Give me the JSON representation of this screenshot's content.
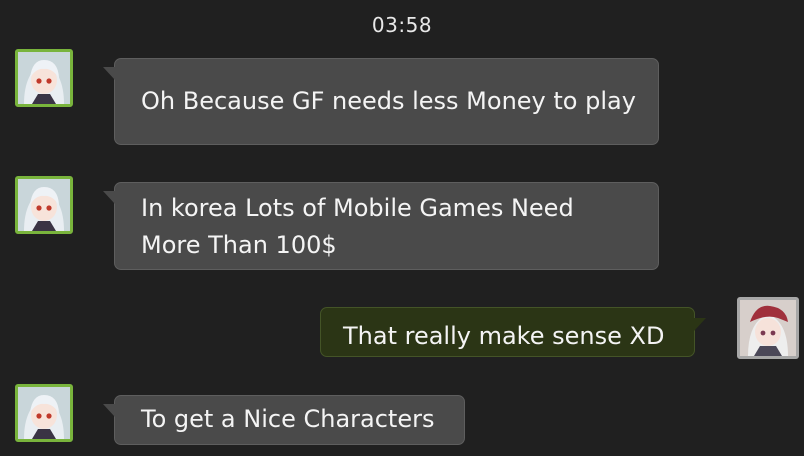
{
  "chat": {
    "timestamp": "03:58",
    "messages": [
      {
        "sender": "npc",
        "avatar": "npc-avatar-icon",
        "lines": [
          "Oh Because GF needs less Money to play"
        ]
      },
      {
        "sender": "npc",
        "avatar": "npc-avatar-icon",
        "lines": [
          "In korea Lots of Mobile Games Need",
          "More Than 100$"
        ]
      },
      {
        "sender": "player",
        "avatar": "player-avatar-icon",
        "lines": [
          "That really make sense XD"
        ]
      },
      {
        "sender": "npc",
        "avatar": "npc-avatar-icon",
        "lines": [
          "To get a Nice Characters"
        ]
      }
    ]
  },
  "colors": {
    "background": "#202020",
    "npc_bubble": "#4a4a4a",
    "player_bubble": "#2b3515",
    "npc_avatar_border": "#79b43c",
    "player_avatar_border": "#a7a7a7"
  }
}
